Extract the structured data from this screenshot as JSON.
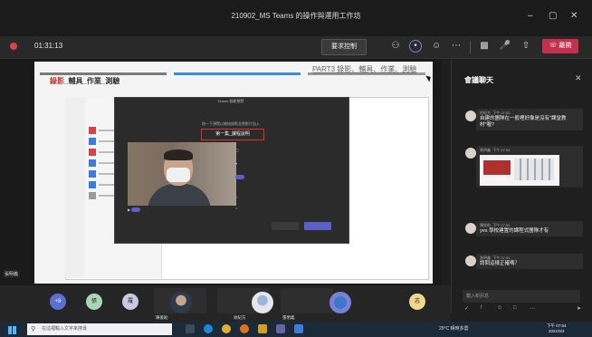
{
  "window": {
    "title": "210902_MS Teams 的操作與運用工作坊",
    "controls": [
      "–",
      "▢",
      "✕"
    ]
  },
  "meeting": {
    "timer": "01:31:13",
    "request_control": "要求控制",
    "leave": "離開",
    "toolbar_icons": [
      "participants-icon",
      "chat-icon",
      "reactions-icon",
      "more-icon",
      "camera-off-icon",
      "mic-off-icon",
      "share-icon"
    ]
  },
  "slide": {
    "heading_red": "錄影",
    "heading_rest": "_輔具_作業_測驗",
    "part": "PART3 錄影、輔具、作業、測驗"
  },
  "dialog": {
    "title": "Teams 錄影預覽",
    "subtitle": "按一下預覽以開始錄影並將影片加入",
    "highlight": "第一集_課程說明"
  },
  "presenter_label": "張明義",
  "chat": {
    "title": "會議聊天",
    "messages": [
      {
        "sender": "徐紀方",
        "time": "下午 07:53",
        "text": "自建的團隊在一般裡好像是沒有\"課堂教材\"喔?"
      },
      {
        "sender": "張明義",
        "time": "下午 07:54",
        "text": ""
      },
      {
        "sender": "陳俊助",
        "time": "下午 07:54",
        "text": "yes 學校建置的課程式團隊才有"
      },
      {
        "sender": "張明義",
        "time": "下午 07:54",
        "text": "請問這樣正確嗎？"
      }
    ],
    "compose_placeholder": "鍵入新訊息",
    "compose_tools": [
      "format-icon",
      "attach-icon",
      "emoji-icon",
      "gif-icon",
      "more-icon",
      "send-icon"
    ]
  },
  "participants": [
    {
      "initial": "+8",
      "color": "#5b6fd1",
      "name": ""
    },
    {
      "initial": "張",
      "color": "#a8d5b5",
      "name": ""
    },
    {
      "initial": "羅",
      "color": "#c8c8e0",
      "name": ""
    },
    {
      "initial": "",
      "color": "#888",
      "name": "陳俊助"
    },
    {
      "initial": "",
      "color": "#888",
      "name": "徐紀方"
    },
    {
      "initial": "",
      "color": "#888",
      "name": "張明義"
    },
    {
      "initial": "志",
      "color": "#f0d78c",
      "name": ""
    }
  ],
  "taskbar": {
    "search_placeholder": "在這裡輸入文字來搜尋",
    "weather": "29°C 晴時多雲",
    "time": "下午 07:54",
    "date": "2021/9/2"
  }
}
